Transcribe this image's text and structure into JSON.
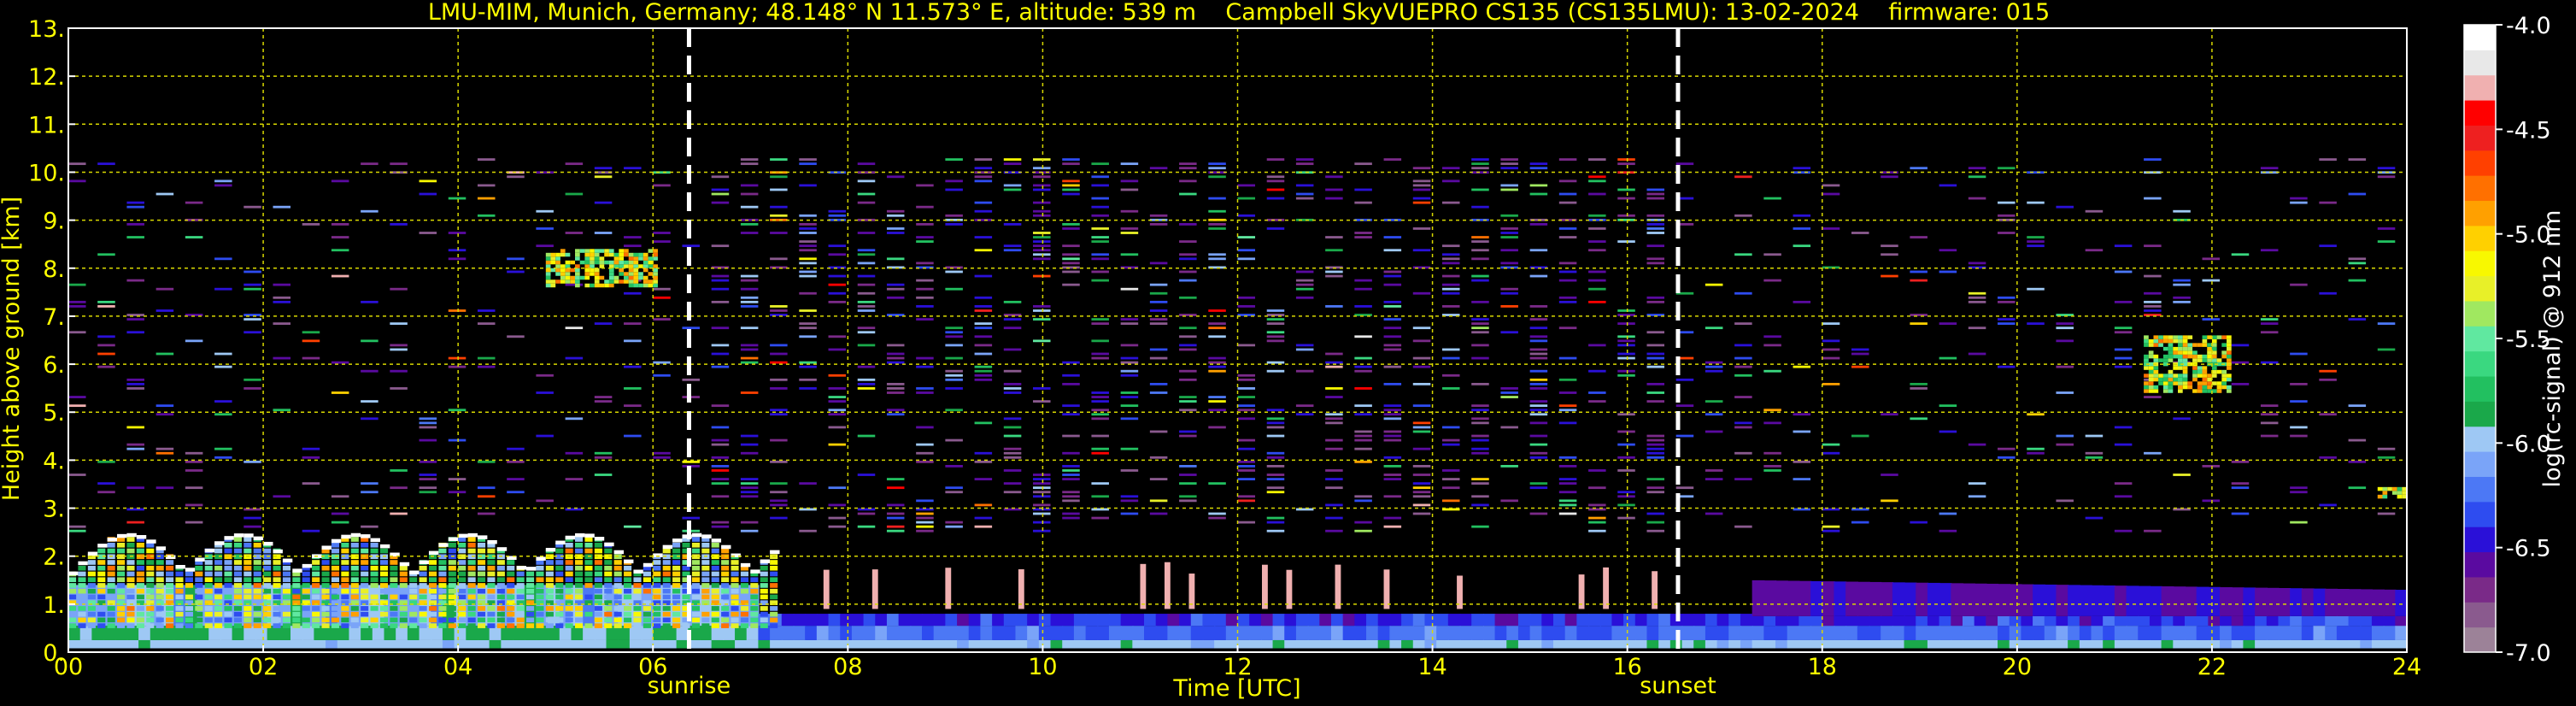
{
  "chart_data": {
    "type": "heatmap",
    "title": "LMU-MIM, Munich, Germany; 48.148° N 11.573° E, altitude: 539 m    Campbell SkyVUEPRO CS135 (CS135LMU): 13-02-2024    firmware: 015",
    "xlabel": "Time [UTC]",
    "ylabel": "Height above ground [km]",
    "xlim": [
      0,
      24
    ],
    "ylim": [
      0,
      13
    ],
    "x_tick_labels": [
      "00",
      "02",
      "04",
      "06",
      "08",
      "10",
      "12",
      "14",
      "16",
      "18",
      "20",
      "22",
      "24"
    ],
    "x_tick_values": [
      0,
      2,
      4,
      6,
      8,
      10,
      12,
      14,
      16,
      18,
      20,
      22,
      24
    ],
    "y_tick_labels": [
      "0.",
      "1.",
      "2.",
      "3.",
      "4.",
      "5.",
      "6.",
      "7.",
      "8.",
      "9.",
      "10.",
      "11.",
      "12.",
      "13."
    ],
    "y_tick_values": [
      0,
      1,
      2,
      3,
      4,
      5,
      6,
      7,
      8,
      9,
      10,
      11,
      12,
      13
    ],
    "grid": true,
    "annotations": [
      {
        "label": "sunrise",
        "x": 6.37
      },
      {
        "label": "sunset",
        "x": 16.52
      }
    ],
    "colorbar": {
      "label": "log(rc-signal) @ 912 nm",
      "min": -7.0,
      "max": -4.0,
      "tick_labels": [
        "-4.0",
        "-4.5",
        "-5.0",
        "-5.5",
        "-6.0",
        "-6.5",
        "-7.0"
      ],
      "tick_values": [
        -4.0,
        -4.5,
        -5.0,
        -5.5,
        -6.0,
        -6.5,
        -7.0
      ],
      "colors": [
        "#9c8298",
        "#8a5a8e",
        "#7a2a88",
        "#5a0aa0",
        "#2a10d8",
        "#2e4cf0",
        "#4c78f5",
        "#7aa4f8",
        "#9ec8f4",
        "#1aa84a",
        "#22c060",
        "#3ad880",
        "#60e8a0",
        "#a0e860",
        "#e8f028",
        "#f8f800",
        "#ffd000",
        "#ffa000",
        "#ff7000",
        "#ff4000",
        "#ee2020",
        "#ff0000",
        "#f0b0b0",
        "#e8e8e8",
        "#ffffff"
      ]
    },
    "features": [
      {
        "name": "noise layer top",
        "height_km": 10.25
      },
      {
        "name": "boundary layer cloud",
        "x_range": [
          0,
          7.2
        ],
        "height_km": [
          1.6,
          2.5
        ]
      },
      {
        "name": "cloud patch",
        "x_range": [
          4.9,
          6.0
        ],
        "height_km": [
          7.6,
          8.4
        ]
      },
      {
        "name": "cloud patch",
        "x_range": [
          21.3,
          22.2
        ],
        "height_km": [
          5.4,
          6.6
        ]
      },
      {
        "name": "cloud patch",
        "x_range": [
          23.7,
          24.0
        ],
        "height_km": [
          3.2,
          3.4
        ]
      }
    ],
    "colors": {
      "axes_text": "#ffff00",
      "grid": "#d8d800",
      "frame": "#ffffff",
      "marker": "#ffffff",
      "background": "#000000"
    }
  }
}
